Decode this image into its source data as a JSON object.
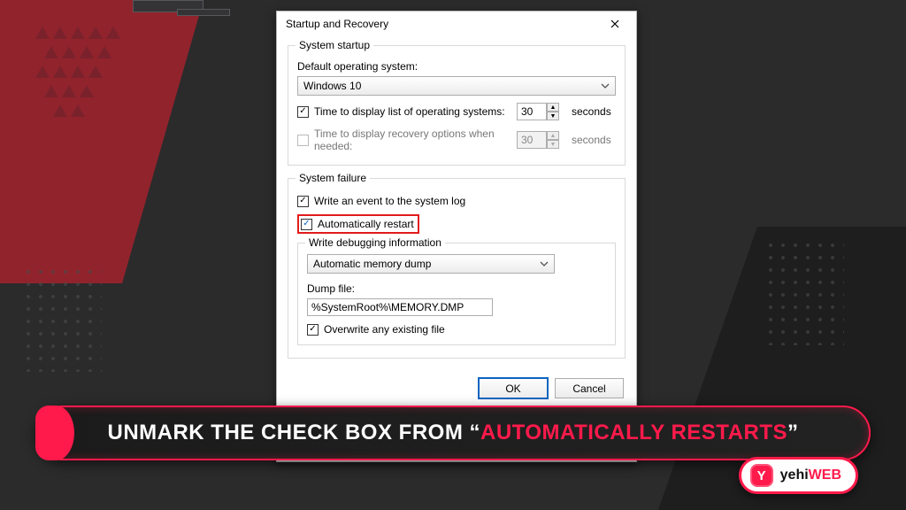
{
  "dialog": {
    "title": "Startup and Recovery",
    "startup_group": {
      "legend": "System startup",
      "default_os_label": "Default operating system:",
      "default_os_value": "Windows 10",
      "time_list": {
        "label": "Time to display list of operating systems:",
        "value": "30",
        "unit": "seconds",
        "checked": true,
        "enabled": true
      },
      "time_recovery": {
        "label": "Time to display recovery options when needed:",
        "value": "30",
        "unit": "seconds",
        "checked": false,
        "enabled": false
      }
    },
    "failure_group": {
      "legend": "System failure",
      "write_event": {
        "label": "Write an event to the system log",
        "checked": true
      },
      "auto_restart": {
        "label": "Automatically restart",
        "checked": true
      },
      "debug_sub": {
        "legend": "Write debugging information",
        "dump_type": "Automatic memory dump",
        "dump_file_label": "Dump file:",
        "dump_file": "%SystemRoot%\\MEMORY.DMP",
        "overwrite": {
          "label": "Overwrite any existing file",
          "checked": true
        }
      }
    },
    "buttons": {
      "ok": "OK",
      "cancel": "Cancel"
    }
  },
  "banner": {
    "prefix": "UNMARK THE CHECK BOX FROM “",
    "accent": "AUTOMATICALLY RESTARTS",
    "suffix": "”"
  },
  "badge": {
    "icon_glyph": "Y",
    "text_left": "yehi",
    "text_right": "WEB"
  }
}
